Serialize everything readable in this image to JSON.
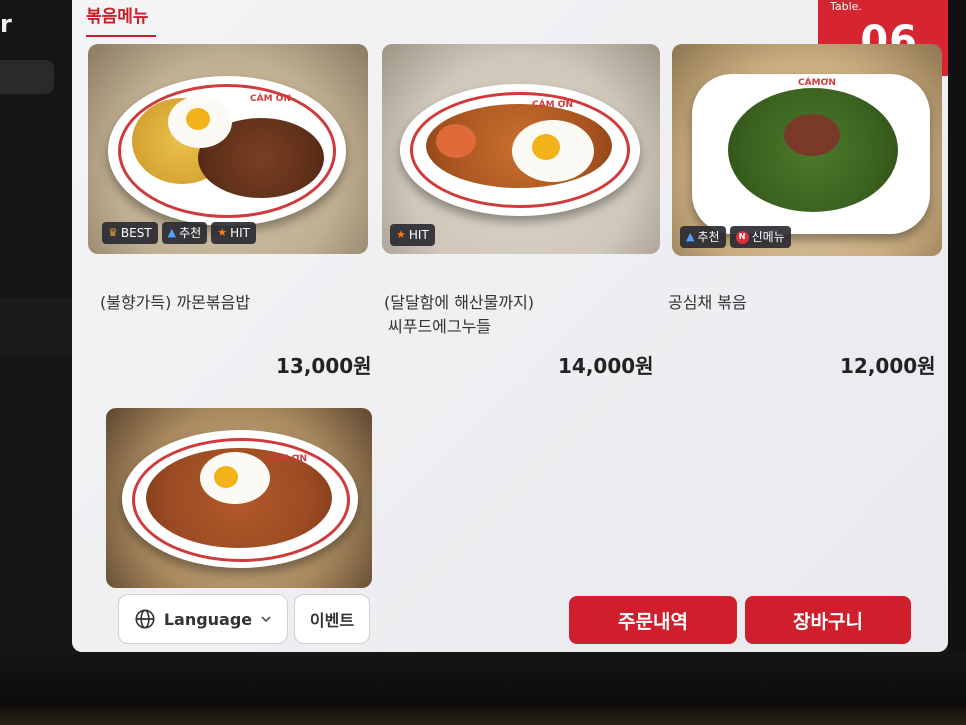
{
  "header": {
    "left_glyph": "r",
    "category_title": "볶음메뉴",
    "table_label": "Table.",
    "table_number": "06"
  },
  "menu_items": [
    {
      "name_line1": "(불향가득) 까몬볶음밥",
      "name_line2": "",
      "price": "13,000원",
      "plate_brand": "CÁM ƠN",
      "badges": [
        {
          "icon": "crown-icon",
          "glyph": "♛",
          "label": "BEST",
          "color": "#e3a33a"
        },
        {
          "icon": "thumbs-up-icon",
          "glyph": "👍",
          "label": "추천",
          "color": "#4ea3ff"
        },
        {
          "icon": "star-icon",
          "glyph": "★",
          "label": "HIT",
          "color": "#ff7a1a"
        }
      ]
    },
    {
      "name_line1": "(달달함에 해산물까지)",
      "name_line2": "씨푸드에그누들",
      "price": "14,000원",
      "plate_brand": "CÁM ƠN",
      "badges": [
        {
          "icon": "star-icon",
          "glyph": "★",
          "label": "HIT",
          "color": "#ff7a1a"
        }
      ]
    },
    {
      "name_line1": "공심채 볶음",
      "name_line2": "",
      "price": "12,000원",
      "plate_brand": "CÁMƠN",
      "badges": [
        {
          "icon": "thumbs-up-icon",
          "glyph": "👍",
          "label": "추천",
          "color": "#4ea3ff"
        },
        {
          "icon": "new-icon",
          "glyph": "N",
          "label": "신메뉴",
          "color": "#e0303a"
        }
      ]
    },
    {
      "name_line1": "",
      "name_line2": "",
      "price": "",
      "plate_brand": "CÁM ƠN",
      "badges": []
    }
  ],
  "footer": {
    "language_label": "Language",
    "event_label": "이벤트",
    "order_history_label": "주문내역",
    "cart_label": "장바구니"
  },
  "colors": {
    "accent": "#cf1f2c",
    "screen_bg": "#f1f1f4"
  }
}
